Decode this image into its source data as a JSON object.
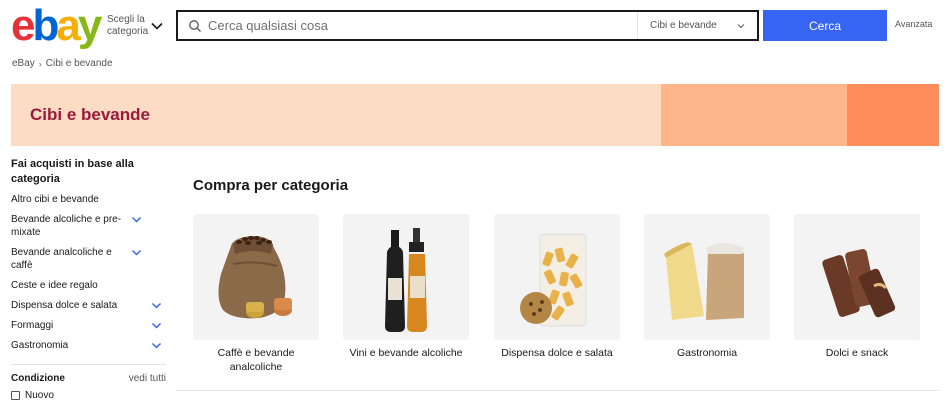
{
  "header": {
    "logo_letters": [
      "e",
      "b",
      "a",
      "y"
    ],
    "category_toggle_label": "Scegli la categoria",
    "search_placeholder": "Cerca qualsiasi cosa",
    "search_category": "Cibi e bevande",
    "search_button": "Cerca",
    "advanced_link": "Avanzata"
  },
  "breadcrumb": {
    "root": "eBay",
    "current": "Cibi e bevande"
  },
  "banner": {
    "title": "Cibi e bevande"
  },
  "sidebar": {
    "title": "Fai acquisti in base alla categoria",
    "items": [
      {
        "label": "Altro cibi e bevande",
        "expandable": false
      },
      {
        "label": "Bevande alcoliche e pre-mixate",
        "expandable": true
      },
      {
        "label": "Bevande analcoliche e caffè",
        "expandable": true
      },
      {
        "label": "Ceste e idee regalo",
        "expandable": false
      },
      {
        "label": "Dispensa dolce e salata",
        "expandable": true
      },
      {
        "label": "Formaggi",
        "expandable": true
      },
      {
        "label": "Gastronomia",
        "expandable": true
      }
    ],
    "condition": {
      "title": "Condizione",
      "see_all": "vedi tutti",
      "options": [
        "Nuovo"
      ]
    }
  },
  "main": {
    "section_title": "Compra per categoria",
    "categories": [
      {
        "label": "Caffè e bevande analcoliche",
        "icon": "coffee-sack-icon"
      },
      {
        "label": "Vini e bevande alcoliche",
        "icon": "wine-bottles-icon"
      },
      {
        "label": "Dispensa dolce e salata",
        "icon": "pasta-bag-icon"
      },
      {
        "label": "Gastronomia",
        "icon": "cheese-flour-icon"
      },
      {
        "label": "Dolci e snack",
        "icon": "chocolate-bars-icon"
      }
    ]
  },
  "colors": {
    "search_button": "#3665f3",
    "banner_bg": "#fddcc4",
    "banner_title": "#9b1a3c",
    "chevron": "#3665f3"
  }
}
